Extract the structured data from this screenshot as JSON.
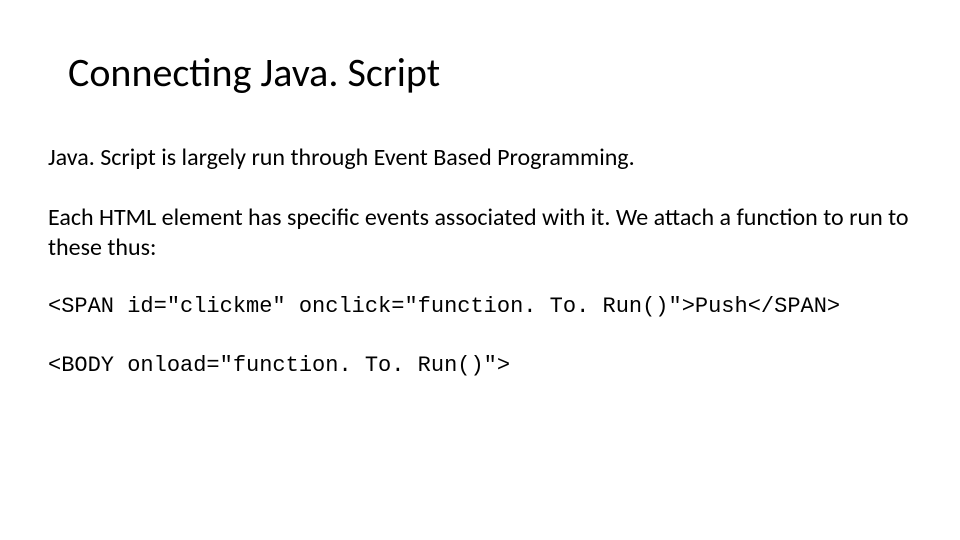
{
  "slide": {
    "title": "Connecting Java. Script",
    "paragraph1": "Java. Script is largely run through Event Based Programming.",
    "paragraph2": "Each HTML element has specific events associated with it. We attach a function to run to these thus:",
    "code1": "<SPAN id=\"clickme\" onclick=\"function. To. Run()\">Push</SPAN>",
    "code2": "<BODY onload=\"function. To. Run()\">"
  }
}
